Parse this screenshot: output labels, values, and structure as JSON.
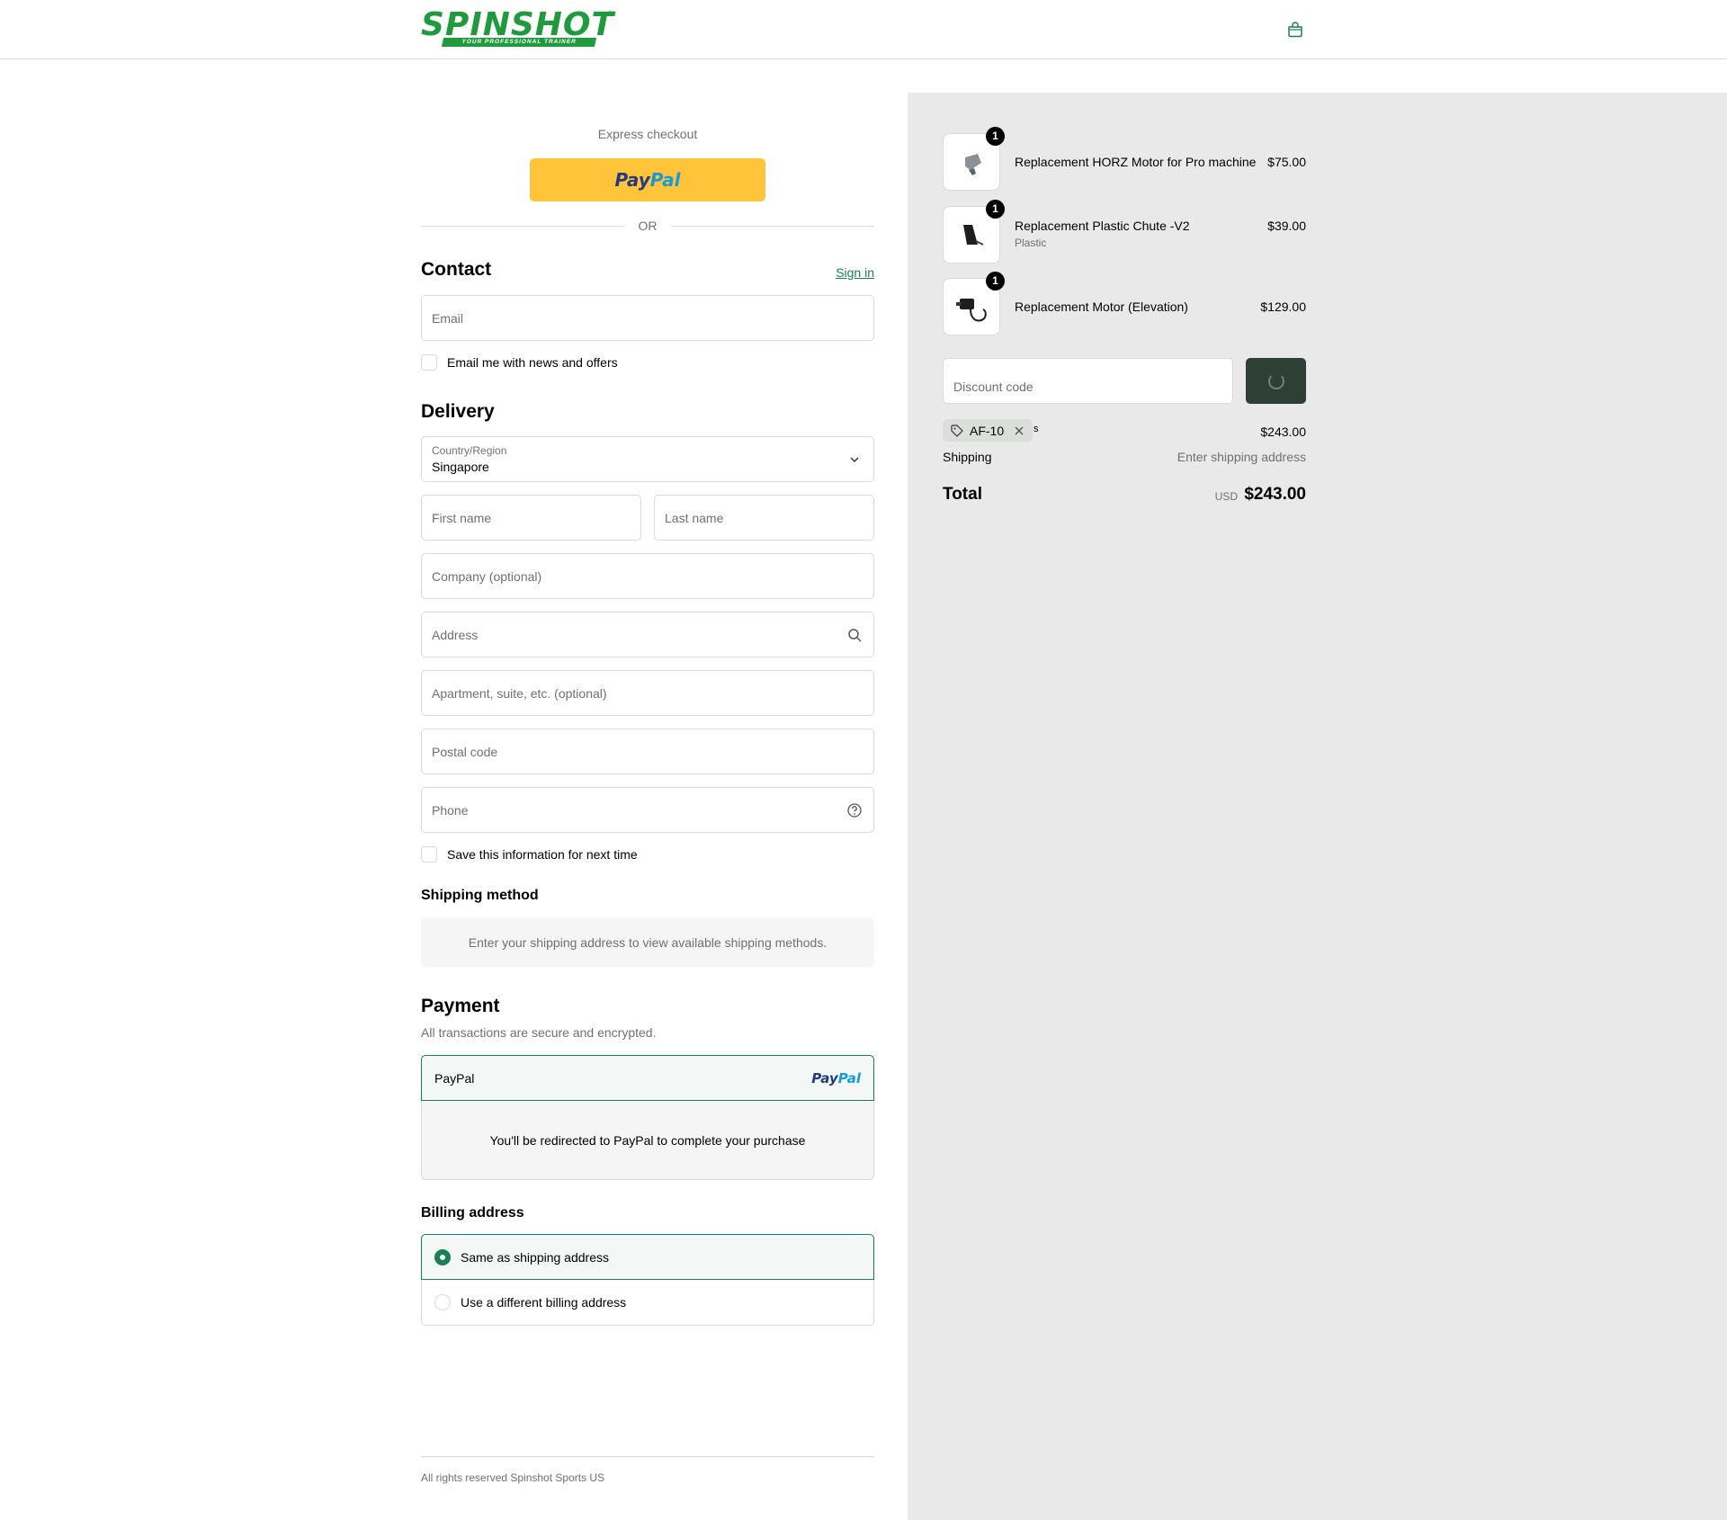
{
  "header": {
    "logo_text": "SPINSHOT",
    "logo_tm": "™",
    "logo_tagline": "YOUR PROFESSIONAL TRAINER"
  },
  "express": {
    "label": "Express checkout",
    "paypal_pay": "Pay",
    "paypal_pal": "Pal",
    "or": "OR"
  },
  "contact": {
    "title": "Contact",
    "sign_in": "Sign in",
    "email_placeholder": "Email",
    "news_label": "Email me with news and offers"
  },
  "delivery": {
    "title": "Delivery",
    "country_label": "Country/Region",
    "country_value": "Singapore",
    "first_name": "First name",
    "last_name": "Last name",
    "company": "Company (optional)",
    "address": "Address",
    "apartment": "Apartment, suite, etc. (optional)",
    "postal": "Postal code",
    "phone": "Phone",
    "save_label": "Save this information for next time"
  },
  "shipping_method": {
    "title": "Shipping method",
    "note": "Enter your shipping address to view available shipping methods."
  },
  "payment": {
    "title": "Payment",
    "secure": "All transactions are secure and encrypted.",
    "option_name": "PayPal",
    "option_logo_pay": "Pay",
    "option_logo_pal": "Pal",
    "redirect": "You'll be redirected to PayPal to complete your purchase"
  },
  "billing": {
    "title": "Billing address",
    "same": "Same as shipping address",
    "different": "Use a different billing address"
  },
  "footer": {
    "text": "All rights reserved Spinshot Sports US"
  },
  "order": {
    "items": [
      {
        "qty": "1",
        "title": "Replacement HORZ Motor for Pro machine",
        "variant": "",
        "price": "$75.00"
      },
      {
        "qty": "1",
        "title": "Replacement Plastic Chute -V2",
        "variant": "Plastic",
        "price": "$39.00"
      },
      {
        "qty": "1",
        "title": "Replacement Motor (Elevation)",
        "variant": "",
        "price": "$129.00"
      }
    ],
    "discount_placeholder": "Discount code",
    "discount_tag": "AF-10",
    "discount_tail": "s",
    "subtotal_value": "$243.00",
    "shipping_label": "Shipping",
    "shipping_value": "Enter shipping address",
    "total_label": "Total",
    "total_currency": "USD",
    "total_value": "$243.00"
  },
  "colors": {
    "brand_green": "#1f9b3e",
    "accent": "#1a7f53",
    "paypal_yellow": "#ffc439",
    "apply_button": "#2e4035",
    "summary_bg": "#e8e9e8"
  }
}
